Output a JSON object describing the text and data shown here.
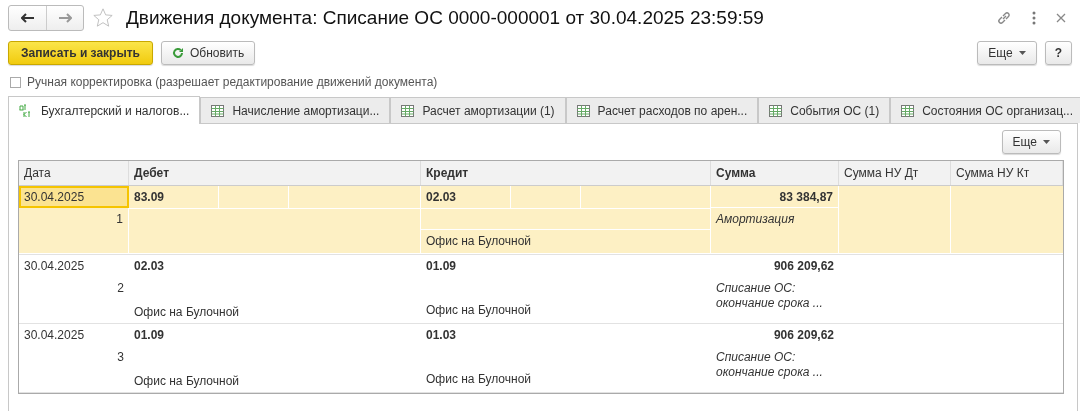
{
  "window": {
    "title": "Движения документа: Списание ОС 0000-000001 от 30.04.2025 23:59:59"
  },
  "toolbar": {
    "primary": "Записать и закрыть",
    "refresh": "Обновить",
    "more": "Еще",
    "help": "?"
  },
  "manual_edit": {
    "label": "Ручная корректировка (разрешает редактирование движений документа)",
    "checked": false
  },
  "tabs": [
    {
      "label": "Бухгалтерский и налогов...",
      "kind": "dt-kt",
      "selected": true
    },
    {
      "label": "Начисление амортизаци...",
      "kind": "table",
      "selected": false
    },
    {
      "label": "Расчет амортизации (1)",
      "kind": "table",
      "selected": false
    },
    {
      "label": "Расчет расходов по арен...",
      "kind": "table",
      "selected": false
    },
    {
      "label": "События ОС (1)",
      "kind": "table",
      "selected": false
    },
    {
      "label": "Состояния ОС организац...",
      "kind": "table",
      "selected": false
    }
  ],
  "table_more": "Еще",
  "table": {
    "columns": [
      "Дата",
      "Дебет",
      "Кредит",
      "Сумма",
      "Сумма НУ Дт",
      "Сумма НУ Кт"
    ],
    "rows": [
      {
        "date": "30.04.2025",
        "number": "1",
        "debit": "83.09",
        "credit": "02.03",
        "credit_sub": "Офис на Булочной",
        "sum": "83 384,87",
        "content": "Амортизация",
        "selected": true
      },
      {
        "date": "30.04.2025",
        "number": "2",
        "debit": "02.03",
        "debit_sub": "Офис на Булочной",
        "credit": "01.09",
        "credit_sub": "Офис на Булочной",
        "sum": "906 209,62",
        "content": "Списание ОС: окончание срока ...",
        "selected": false
      },
      {
        "date": "30.04.2025",
        "number": "3",
        "debit": "01.09",
        "debit_sub": "Офис на Булочной",
        "credit": "01.03",
        "credit_sub": "Офис на Булочной",
        "sum": "906 209,62",
        "content": "Списание ОС: окончание срока ...",
        "selected": false
      }
    ]
  }
}
